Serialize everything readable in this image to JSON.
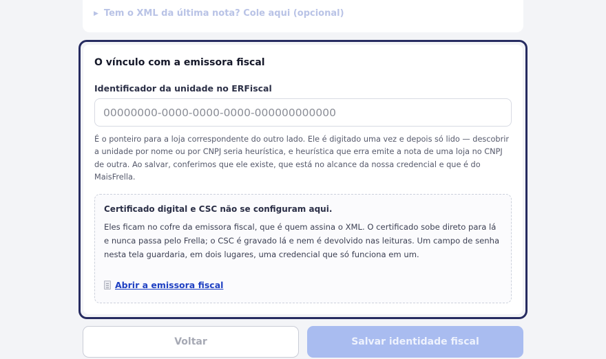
{
  "xml_toggle": {
    "icon": "triangle-right-icon",
    "label": "Tem o XML da última nota? Cole aqui (opcional)"
  },
  "card": {
    "title": "O vínculo com a emissora fiscal",
    "field_label": "Identificador da unidade no ERFiscal",
    "field_placeholder": "00000000-0000-0000-0000-000000000000",
    "field_value": "",
    "help_text": "É o ponteiro para a loja correspondente do outro lado. Ele é digitado uma vez e depois só lido — descobrir a unidade por nome ou por CNPJ seria heurística, e heurística que erra emite a nota de uma loja no CNPJ de outra. Ao salvar, conferimos que ele existe, que está no alcance da nossa credencial e que é do MaisFrella."
  },
  "notice": {
    "title": "Certificado digital e CSC não se configuram aqui.",
    "body": "Eles ficam no cofre da emissora fiscal, que é quem assina o XML. O certificado sobe direto para lá e nunca passa pelo Frella; o CSC é gravado lá e nem é devolvido nas leituras. Um campo de senha nesta tela guardaria, em dois lugares, uma credencial que só funciona em um.",
    "link_icon": "document-icon",
    "link_label": "Abrir a emissora fiscal"
  },
  "actions": {
    "back_label": "Voltar",
    "save_label": "Salvar identidade fiscal"
  },
  "colors": {
    "focus_ring": "#262b60",
    "link": "#1d3fc2",
    "save_button": "#a9bcf0"
  }
}
